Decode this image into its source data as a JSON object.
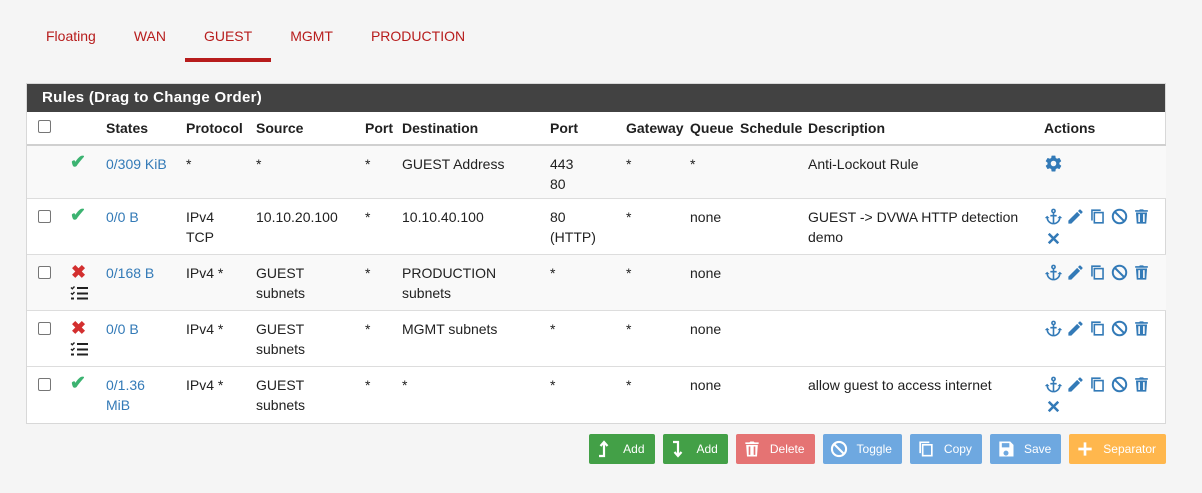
{
  "tabs": [
    {
      "label": "Floating"
    },
    {
      "label": "WAN"
    },
    {
      "label": "GUEST"
    },
    {
      "label": "MGMT"
    },
    {
      "label": "PRODUCTION"
    }
  ],
  "active_tab": "GUEST",
  "panel": {
    "title": "Rules (Drag to Change Order)"
  },
  "columns": {
    "states": "States",
    "protocol": "Protocol",
    "source": "Source",
    "port": "Port",
    "destination": "Destination",
    "dport": "Port",
    "gateway": "Gateway",
    "queue": "Queue",
    "schedule": "Schedule",
    "description": "Description",
    "actions": "Actions"
  },
  "rows": [
    {
      "status": "pass",
      "states": "0/309 KiB",
      "protocol": "*",
      "protocol2": "",
      "source": "*",
      "source2": "",
      "port": "*",
      "destination": "GUEST Address",
      "destination2": "",
      "dport": "443",
      "dport2": "80",
      "gateway": "*",
      "queue": "*",
      "schedule": "",
      "description": "Anti-Lockout Rule",
      "description2": ""
    },
    {
      "status": "pass",
      "states": "0/0 B",
      "protocol": "IPv4",
      "protocol2": "TCP",
      "source": "10.10.20.100",
      "source2": "",
      "port": "*",
      "destination": "10.10.40.100",
      "destination2": "",
      "dport": "80",
      "dport2": "(HTTP)",
      "gateway": "*",
      "queue": "none",
      "schedule": "",
      "description": "GUEST -> DVWA HTTP detection",
      "description2": "demo"
    },
    {
      "status": "block",
      "states": "0/168 B",
      "protocol": "IPv4 *",
      "protocol2": "",
      "source": "GUEST",
      "source2": "subnets",
      "port": "*",
      "destination": "PRODUCTION",
      "destination2": "subnets",
      "dport": "*",
      "dport2": "",
      "gateway": "*",
      "queue": "none",
      "schedule": "",
      "description": "",
      "description2": ""
    },
    {
      "status": "block",
      "states": "0/0 B",
      "protocol": "IPv4 *",
      "protocol2": "",
      "source": "GUEST",
      "source2": "subnets",
      "port": "*",
      "destination": "MGMT subnets",
      "destination2": "",
      "dport": "*",
      "dport2": "",
      "gateway": "*",
      "queue": "none",
      "schedule": "",
      "description": "",
      "description2": ""
    },
    {
      "status": "pass",
      "states": "0/1.36",
      "states2": "MiB",
      "protocol": "IPv4 *",
      "protocol2": "",
      "source": "GUEST",
      "source2": "subnets",
      "port": "*",
      "destination": "*",
      "destination2": "",
      "dport": "*",
      "dport2": "",
      "gateway": "*",
      "queue": "none",
      "schedule": "",
      "description": "allow guest to access internet",
      "description2": ""
    }
  ],
  "buttons": {
    "add_top": "Add",
    "add_bottom": "Add",
    "delete": "Delete",
    "toggle": "Toggle",
    "copy": "Copy",
    "save": "Save",
    "separator": "Separator"
  },
  "colors": {
    "tab_red": "#b71c1c",
    "heading": "#424242",
    "pass": "#3cb371",
    "block": "#d32f2f",
    "link": "#337ab7",
    "green_btn": "#43a047",
    "red_btn": "#e57373",
    "blue_btn": "#6ea8e0",
    "orange_btn": "#ffb74d"
  },
  "icons": {
    "anchor": "anchor-icon",
    "edit": "pencil-icon",
    "copy": "copy-icon",
    "disable": "ban-icon",
    "delete": "trash-icon",
    "gear": "gear-icon",
    "remove": "close-icon"
  }
}
